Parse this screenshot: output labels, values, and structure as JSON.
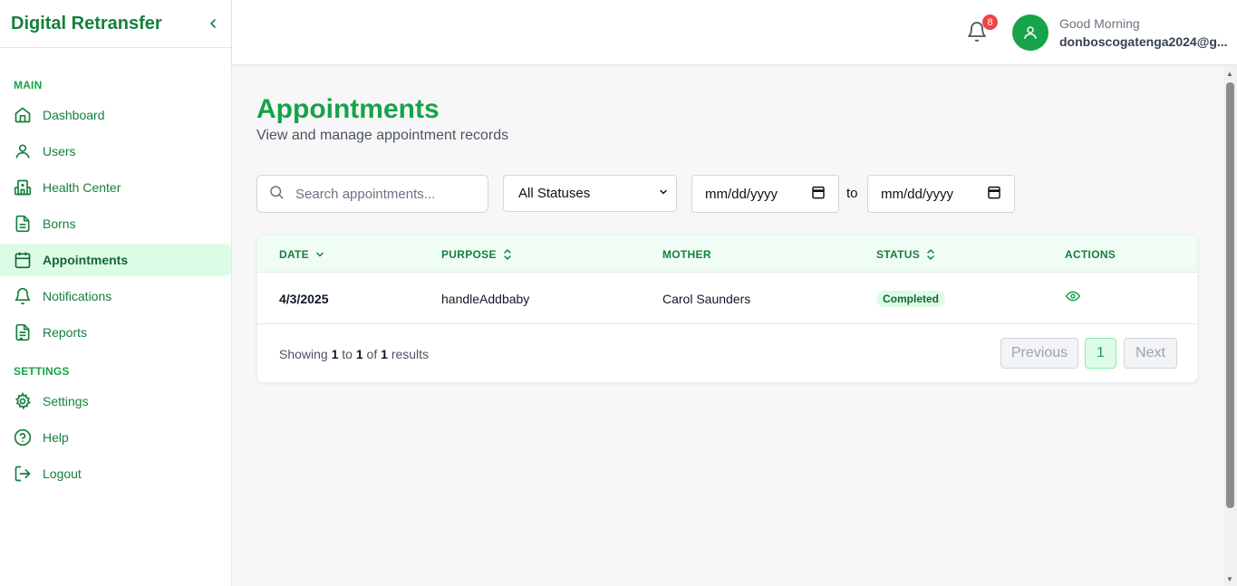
{
  "app": {
    "title": "Digital Retransfer"
  },
  "sidebar": {
    "sections": [
      {
        "label": "MAIN"
      },
      {
        "label": "SETTINGS"
      }
    ],
    "items": [
      {
        "label": "Dashboard",
        "icon": "home-icon"
      },
      {
        "label": "Users",
        "icon": "user-icon"
      },
      {
        "label": "Health Center",
        "icon": "hospital-icon"
      },
      {
        "label": "Borns",
        "icon": "document-icon"
      },
      {
        "label": "Appointments",
        "icon": "calendar-icon",
        "active": true
      },
      {
        "label": "Notifications",
        "icon": "bell-icon"
      },
      {
        "label": "Reports",
        "icon": "report-icon"
      },
      {
        "label": "Settings",
        "icon": "gear-icon"
      },
      {
        "label": "Help",
        "icon": "help-icon"
      },
      {
        "label": "Logout",
        "icon": "logout-icon"
      }
    ]
  },
  "header": {
    "notification_count": "8",
    "greeting": "Good Morning",
    "user_email": "donboscogatenga2024@g..."
  },
  "page": {
    "title": "Appointments",
    "subtitle": "View and manage appointment records"
  },
  "filters": {
    "search_placeholder": "Search appointments...",
    "status_value": "All Statuses",
    "date_from": "mm/dd/yyyy",
    "to_label": "to",
    "date_to": "mm/dd/yyyy"
  },
  "table": {
    "columns": [
      "DATE",
      "PURPOSE",
      "MOTHER",
      "STATUS",
      "ACTIONS"
    ],
    "rows": [
      {
        "date": "4/3/2025",
        "purpose": "handleAddbaby",
        "mother": "Carol Saunders",
        "status": "Completed"
      }
    ],
    "footer": {
      "showing": "Showing",
      "from": "1",
      "to_word": "to",
      "to": "1",
      "of_word": "of",
      "total": "1",
      "results": "results"
    },
    "pagination": {
      "previous": "Previous",
      "current": "1",
      "next": "Next"
    }
  },
  "colors": {
    "brand": "#16a34a",
    "brand_dark": "#15803d",
    "active_bg": "#dcfce7",
    "badge_red": "#ef4444"
  }
}
